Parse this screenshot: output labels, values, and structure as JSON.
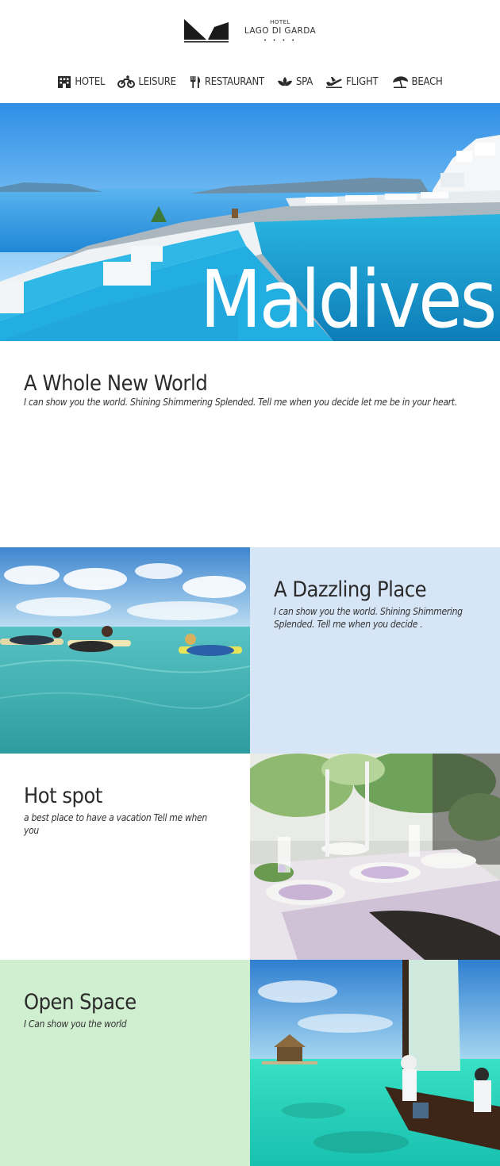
{
  "brand": {
    "top_line": "HOTEL",
    "name": "LAGO DI GARDA",
    "stars": "• • • •"
  },
  "nav": {
    "items": [
      {
        "label": "HOTEL",
        "icon": "hotel-icon"
      },
      {
        "label": "LEISURE",
        "icon": "bicycle-icon"
      },
      {
        "label": "RESTAURANT",
        "icon": "cutlery-icon"
      },
      {
        "label": "SPA",
        "icon": "lotus-icon"
      },
      {
        "label": "FLIGHT",
        "icon": "plane-icon"
      },
      {
        "label": "BEACH",
        "icon": "umbrella-icon"
      }
    ]
  },
  "hero": {
    "title": "Maldives"
  },
  "intro": {
    "title": "A Whole New World",
    "text": "I can show you the world. Shining Shimmering Splended. Tell me when you decide let me be in your heart."
  },
  "sections": [
    {
      "title": "A Dazzling Place",
      "text": "I can show you the world. Shining Shimmering Splended. Tell me when you decide .",
      "background": "#d7e6f7"
    },
    {
      "title": "Hot spot",
      "text": "a best place to have a vacation Tell me when you",
      "background": "#ffffff"
    },
    {
      "title": "Open Space",
      "text": "I Can show you the world",
      "background": "#d0eed0"
    }
  ]
}
